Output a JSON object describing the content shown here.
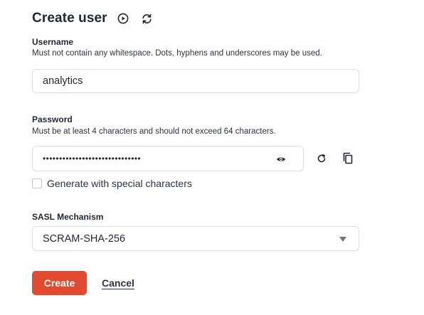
{
  "header": {
    "title": "Create user",
    "icons": [
      "play-circle-icon",
      "refresh-icon"
    ]
  },
  "username": {
    "label": "Username",
    "help": "Must not contain any whitespace. Dots, hyphens and underscores may be used.",
    "value": "analytics"
  },
  "password": {
    "label": "Password",
    "help": "Must be at least 4 characters and should not exceed 64 characters.",
    "value": "••••••••••••••••••••••••••••••",
    "icons": [
      "eye-icon",
      "regenerate-icon",
      "copy-icon"
    ]
  },
  "special_chars": {
    "label": "Generate with special characters",
    "checked": false
  },
  "sasl": {
    "label": "SASL Mechanism",
    "selected": "SCRAM-SHA-256"
  },
  "actions": {
    "create_label": "Create",
    "cancel_label": "Cancel"
  },
  "colors": {
    "primary": "#e14a2f",
    "text": "#1f2733",
    "border": "#dcdfe4"
  }
}
